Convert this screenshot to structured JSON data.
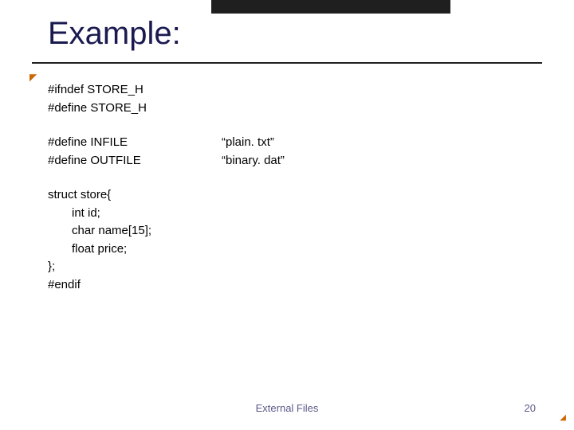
{
  "title": "Example:",
  "code": {
    "guard_ifndef": "#ifndef STORE_H",
    "guard_define": "#define STORE_H",
    "define_infile_l": "#define INFILE",
    "define_infile_r": "“plain. txt”",
    "define_outfile_l": "#define OUTFILE",
    "define_outfile_r": "“binary. dat”",
    "struct_open": "struct store{",
    "field_id": "int id;",
    "field_name": "char name[15];",
    "field_price": "float price;",
    "struct_close": "};",
    "endif": "#endif"
  },
  "footer": {
    "center": "External Files",
    "page": "20"
  }
}
